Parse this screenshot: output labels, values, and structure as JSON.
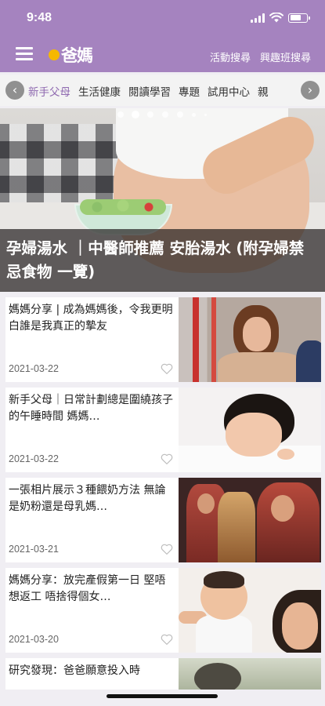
{
  "status_bar": {
    "time": "9:48",
    "battery_level": 0.7
  },
  "header": {
    "logo_text": "爸媽",
    "links": [
      "活動搜尋",
      "興趣班搜尋"
    ]
  },
  "category_bar": {
    "prev_arrow": "‹",
    "next_arrow": "›",
    "items": [
      "新手父母",
      "生活健康",
      "閱讀學習",
      "專題",
      "試用中心",
      "親"
    ],
    "active_index": 0
  },
  "hero": {
    "title": "孕婦湯水 ｜中醫師推薦 安胎湯水 (附孕婦禁忌食物 一覽)",
    "slide_count": 7,
    "active_slide": 1
  },
  "articles": [
    {
      "title": "媽媽分享 | 成為媽媽後，令我更明白誰是我真正的摯友",
      "date": "2021-03-22"
    },
    {
      "title": "新手父母｜日常計劃總是圍繞孩子的午睡時間 媽媽…",
      "date": "2021-03-22"
    },
    {
      "title": "一張相片展示３種餵奶方法 無論是奶粉還是母乳媽…",
      "date": "2021-03-21"
    },
    {
      "title": "媽媽分享：放完產假第一日 堅唔想返工 唔捨得個女…",
      "date": "2021-03-20"
    },
    {
      "title": "研究發現：爸爸願意投入時",
      "date": ""
    }
  ],
  "colors": {
    "header_bg": "#a583bf",
    "active_category": "#8f6ab0"
  },
  "icons": {
    "favorite": "heart-outline-icon",
    "menu": "hamburger-menu-icon"
  }
}
